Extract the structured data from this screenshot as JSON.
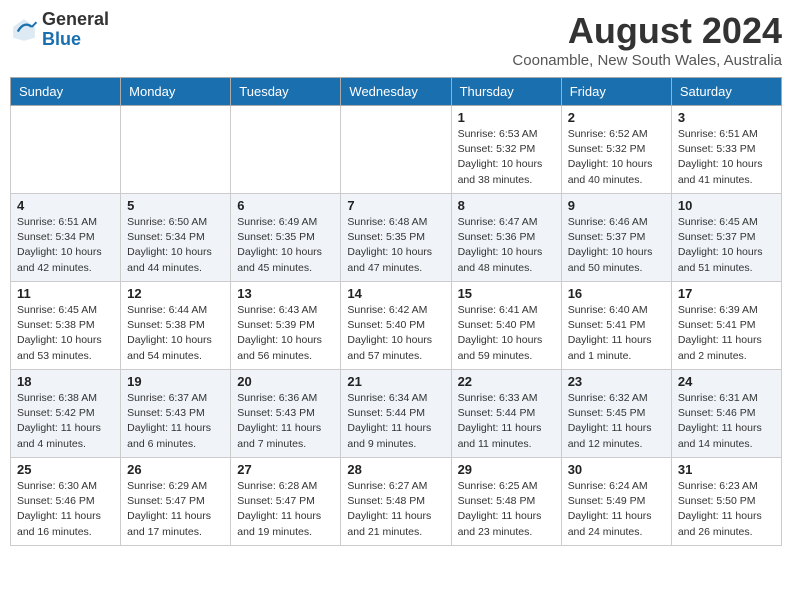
{
  "header": {
    "logo_general": "General",
    "logo_blue": "Blue",
    "month_year": "August 2024",
    "location": "Coonamble, New South Wales, Australia"
  },
  "days_of_week": [
    "Sunday",
    "Monday",
    "Tuesday",
    "Wednesday",
    "Thursday",
    "Friday",
    "Saturday"
  ],
  "weeks": [
    [
      {
        "day": "",
        "info": ""
      },
      {
        "day": "",
        "info": ""
      },
      {
        "day": "",
        "info": ""
      },
      {
        "day": "",
        "info": ""
      },
      {
        "day": "1",
        "info": "Sunrise: 6:53 AM\nSunset: 5:32 PM\nDaylight: 10 hours\nand 38 minutes."
      },
      {
        "day": "2",
        "info": "Sunrise: 6:52 AM\nSunset: 5:32 PM\nDaylight: 10 hours\nand 40 minutes."
      },
      {
        "day": "3",
        "info": "Sunrise: 6:51 AM\nSunset: 5:33 PM\nDaylight: 10 hours\nand 41 minutes."
      }
    ],
    [
      {
        "day": "4",
        "info": "Sunrise: 6:51 AM\nSunset: 5:34 PM\nDaylight: 10 hours\nand 42 minutes."
      },
      {
        "day": "5",
        "info": "Sunrise: 6:50 AM\nSunset: 5:34 PM\nDaylight: 10 hours\nand 44 minutes."
      },
      {
        "day": "6",
        "info": "Sunrise: 6:49 AM\nSunset: 5:35 PM\nDaylight: 10 hours\nand 45 minutes."
      },
      {
        "day": "7",
        "info": "Sunrise: 6:48 AM\nSunset: 5:35 PM\nDaylight: 10 hours\nand 47 minutes."
      },
      {
        "day": "8",
        "info": "Sunrise: 6:47 AM\nSunset: 5:36 PM\nDaylight: 10 hours\nand 48 minutes."
      },
      {
        "day": "9",
        "info": "Sunrise: 6:46 AM\nSunset: 5:37 PM\nDaylight: 10 hours\nand 50 minutes."
      },
      {
        "day": "10",
        "info": "Sunrise: 6:45 AM\nSunset: 5:37 PM\nDaylight: 10 hours\nand 51 minutes."
      }
    ],
    [
      {
        "day": "11",
        "info": "Sunrise: 6:45 AM\nSunset: 5:38 PM\nDaylight: 10 hours\nand 53 minutes."
      },
      {
        "day": "12",
        "info": "Sunrise: 6:44 AM\nSunset: 5:38 PM\nDaylight: 10 hours\nand 54 minutes."
      },
      {
        "day": "13",
        "info": "Sunrise: 6:43 AM\nSunset: 5:39 PM\nDaylight: 10 hours\nand 56 minutes."
      },
      {
        "day": "14",
        "info": "Sunrise: 6:42 AM\nSunset: 5:40 PM\nDaylight: 10 hours\nand 57 minutes."
      },
      {
        "day": "15",
        "info": "Sunrise: 6:41 AM\nSunset: 5:40 PM\nDaylight: 10 hours\nand 59 minutes."
      },
      {
        "day": "16",
        "info": "Sunrise: 6:40 AM\nSunset: 5:41 PM\nDaylight: 11 hours\nand 1 minute."
      },
      {
        "day": "17",
        "info": "Sunrise: 6:39 AM\nSunset: 5:41 PM\nDaylight: 11 hours\nand 2 minutes."
      }
    ],
    [
      {
        "day": "18",
        "info": "Sunrise: 6:38 AM\nSunset: 5:42 PM\nDaylight: 11 hours\nand 4 minutes."
      },
      {
        "day": "19",
        "info": "Sunrise: 6:37 AM\nSunset: 5:43 PM\nDaylight: 11 hours\nand 6 minutes."
      },
      {
        "day": "20",
        "info": "Sunrise: 6:36 AM\nSunset: 5:43 PM\nDaylight: 11 hours\nand 7 minutes."
      },
      {
        "day": "21",
        "info": "Sunrise: 6:34 AM\nSunset: 5:44 PM\nDaylight: 11 hours\nand 9 minutes."
      },
      {
        "day": "22",
        "info": "Sunrise: 6:33 AM\nSunset: 5:44 PM\nDaylight: 11 hours\nand 11 minutes."
      },
      {
        "day": "23",
        "info": "Sunrise: 6:32 AM\nSunset: 5:45 PM\nDaylight: 11 hours\nand 12 minutes."
      },
      {
        "day": "24",
        "info": "Sunrise: 6:31 AM\nSunset: 5:46 PM\nDaylight: 11 hours\nand 14 minutes."
      }
    ],
    [
      {
        "day": "25",
        "info": "Sunrise: 6:30 AM\nSunset: 5:46 PM\nDaylight: 11 hours\nand 16 minutes."
      },
      {
        "day": "26",
        "info": "Sunrise: 6:29 AM\nSunset: 5:47 PM\nDaylight: 11 hours\nand 17 minutes."
      },
      {
        "day": "27",
        "info": "Sunrise: 6:28 AM\nSunset: 5:47 PM\nDaylight: 11 hours\nand 19 minutes."
      },
      {
        "day": "28",
        "info": "Sunrise: 6:27 AM\nSunset: 5:48 PM\nDaylight: 11 hours\nand 21 minutes."
      },
      {
        "day": "29",
        "info": "Sunrise: 6:25 AM\nSunset: 5:48 PM\nDaylight: 11 hours\nand 23 minutes."
      },
      {
        "day": "30",
        "info": "Sunrise: 6:24 AM\nSunset: 5:49 PM\nDaylight: 11 hours\nand 24 minutes."
      },
      {
        "day": "31",
        "info": "Sunrise: 6:23 AM\nSunset: 5:50 PM\nDaylight: 11 hours\nand 26 minutes."
      }
    ]
  ]
}
